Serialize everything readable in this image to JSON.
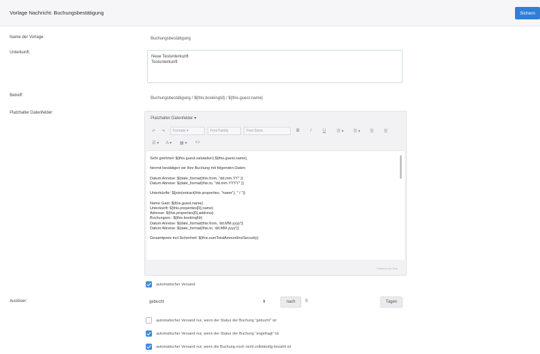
{
  "header": {
    "title": "Vorlage Nachricht: Buchungsbestätigung",
    "save_label": "Sichern"
  },
  "fields": {
    "name_label": "Name der Vorlage:",
    "name_value": "Buchungsbestätigung",
    "accommodation_label": "Unterkunft:",
    "accommodation_lines": [
      "Neue Testunterkunft",
      "Testunterkunft"
    ],
    "subject_label": "Betreff:",
    "subject_value": "Buchungsbestätigung / ${this.bookingId} / ${this.guest.name}",
    "placeholder_label": "Platzhalter Datenfelder:"
  },
  "editor": {
    "placeholder_dropdown": "Platzhalter Datenfelder ▾",
    "toolbar": {
      "undo": "↶",
      "redo": "↷",
      "format_select": "Formate ▾",
      "font_family_select": "Font Family",
      "font_size_select": "Font Sizes",
      "bold": "B",
      "italic": "I",
      "underline": "U",
      "list_bullets": "☰ ▾",
      "list_numbers": "☰ ▾",
      "align_left": "☰",
      "align_center": "☰",
      "align_right": "☰ ▾",
      "text_color": "A ▾",
      "table": "▦ ▾",
      "source": "<>"
    },
    "lines": [
      "Sehr geehrte/r ${this.guest.salutation} ${this.guest.name},",
      "",
      "hiermit bestätigen wir Ihre Buchung mit folgenden Daten:",
      "",
      "Datum Anreise: ${date_format(this.from, \"dd.mm.YY\" )}",
      "Datum Abreise: ${date_format(this.to, \"dd.mm.YYYY\" )}",
      "",
      "Unterkünfte: ${join(extract(this.properties, \"name\"), \" / \")}",
      "",
      "Name Gast: ${this.guest.name}",
      "Unterkunft: ${this.properties[0].name}",
      "Adresse: ${this.properties[0].address}",
      "Buchungsnr.: ${this.bookingNr}",
      "Datum Anreise: ${date_format(this.from, 'dd.MM.yyyy')}",
      "Datum Abreise: ${date_format(this.to, 'dd.MM.yyyy')}",
      "",
      "Gesamtpreis incl.Sicherheit: ${this.sumTotalAmountInclSecurity}"
    ],
    "powered_by": "Powered by Tiny"
  },
  "sending": {
    "auto_label": "automatischer Versand",
    "auto_checked": true,
    "trigger_label": "Auslöser:",
    "trigger_select_value": "gebucht",
    "nach_label": "nach",
    "days_value": "0",
    "days_button": "Tagen",
    "conditions": [
      {
        "label": "automatischer Versand nur, wenn der Status der Buchung \"gebucht\" ist",
        "checked": false
      },
      {
        "label": "automatischer Versand nur, wenn der Status der Buchung \"angefragt\" ist",
        "checked": true
      },
      {
        "label": "automatischer Versand nur, wenn die Buchung noch nicht vollständig bezahlt ist",
        "checked": true
      }
    ]
  },
  "colors": {
    "accent": "#2f7fd8",
    "checkbox": "#3a8ee6"
  }
}
